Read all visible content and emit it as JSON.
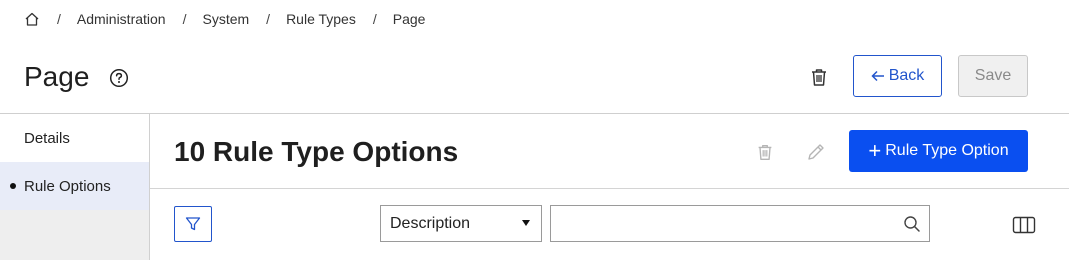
{
  "breadcrumb": {
    "home_icon": "home-icon",
    "items": [
      "Administration",
      "System",
      "Rule Types",
      "Page"
    ],
    "separator": "/"
  },
  "header": {
    "title": "Page",
    "help_icon": "question-circle-icon",
    "delete_icon": "trash-icon",
    "back_label": "Back",
    "save_label": "Save"
  },
  "sidebar": {
    "items": [
      {
        "label": "Details",
        "active": false
      },
      {
        "label": "Rule Options",
        "active": true
      }
    ]
  },
  "content": {
    "title": "10 Rule Type Options",
    "delete_icon": "trash-icon",
    "edit_icon": "pencil-icon",
    "add_label": "Rule Type Option"
  },
  "filter": {
    "filter_icon": "funnel-icon",
    "field_select": "Description",
    "search_value": "",
    "search_icon": "magnifier-icon",
    "columns_icon": "columns-icon"
  },
  "colors": {
    "primary": "#0a4ff0",
    "outline_blue": "#2255cc",
    "sidebar_active_bg": "#e8ecf8",
    "sidebar_bg": "#eeeeee"
  }
}
